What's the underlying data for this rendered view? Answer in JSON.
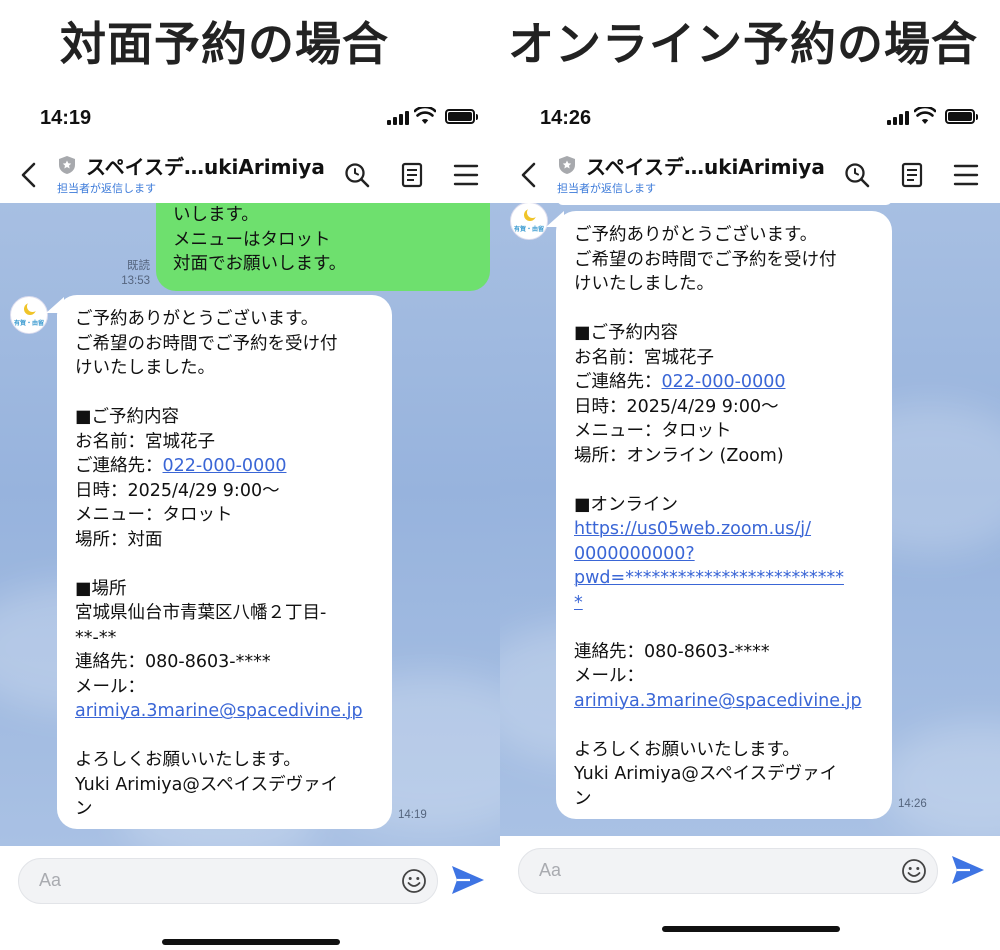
{
  "headings": {
    "left": "対面予約の場合",
    "right": "オンライン予約の場合"
  },
  "left_phone": {
    "status_time": "14:19",
    "chat_title": "スペイスデ…ukiArimiya",
    "chat_subtitle": "担当者が返信します",
    "outgoing": {
      "lines": [
        "いします。",
        "メニューはタロット",
        "対面でお願いします。"
      ],
      "read_label": "既読",
      "time": "13:53"
    },
    "incoming": {
      "avatar_text": "有賀・由留",
      "lines": [
        {
          "text": "ご予約ありがとうございます。"
        },
        {
          "text": "ご希望のお時間でご予約を受け付"
        },
        {
          "text": "けいたしました。"
        },
        {
          "text": ""
        },
        {
          "text": "■ご予約内容"
        },
        {
          "text": "お名前：宮城花子"
        },
        {
          "text": "ご連絡先：",
          "link": "022-000-0000"
        },
        {
          "text": "日時：2025/4/29 9:00～"
        },
        {
          "text": "メニュー：タロット"
        },
        {
          "text": "場所：対面"
        },
        {
          "text": ""
        },
        {
          "text": "■場所"
        },
        {
          "text": "宮城県仙台市青葉区八幡２丁目-"
        },
        {
          "text": "**-**"
        },
        {
          "text": "連絡先：080-8603-****"
        },
        {
          "text": "メール："
        },
        {
          "text": "",
          "link": "arimiya.3marine@spacedivine.jp"
        },
        {
          "text": ""
        },
        {
          "text": "よろしくお願いいたします。"
        },
        {
          "text": "Yuki Arimiya@スペイスデヴァイ"
        },
        {
          "text": "ン"
        }
      ],
      "time": "14:19"
    },
    "input_placeholder": "Aa"
  },
  "right_phone": {
    "status_time": "14:26",
    "chat_title": "スペイスデ…ukiArimiya",
    "chat_subtitle": "担当者が返信します",
    "incoming": {
      "avatar_text": "有賀・由留",
      "lines": [
        {
          "text": "ご予約ありがとうございます。"
        },
        {
          "text": "ご希望のお時間でご予約を受け付"
        },
        {
          "text": "けいたしました。"
        },
        {
          "text": ""
        },
        {
          "text": "■ご予約内容"
        },
        {
          "text": "お名前：宮城花子"
        },
        {
          "text": "ご連絡先：",
          "link": "022-000-0000"
        },
        {
          "text": "日時：2025/4/29 9:00～"
        },
        {
          "text": "メニュー：タロット"
        },
        {
          "text": "場所：オンライン (Zoom)"
        },
        {
          "text": ""
        },
        {
          "text": "■オンライン"
        },
        {
          "text": "",
          "link": "https://us05web.zoom.us/j/"
        },
        {
          "text": "",
          "link": "0000000000?"
        },
        {
          "text": "",
          "link": "pwd=*************************"
        },
        {
          "text": "",
          "link": "*"
        },
        {
          "text": ""
        },
        {
          "text": "連絡先：080-8603-****"
        },
        {
          "text": "メール："
        },
        {
          "text": "",
          "link": "arimiya.3marine@spacedivine.jp"
        },
        {
          "text": ""
        },
        {
          "text": "よろしくお願いいたします。"
        },
        {
          "text": "Yuki Arimiya@スペイスデヴァイ"
        },
        {
          "text": "ン"
        }
      ],
      "time": "14:26"
    },
    "input_placeholder": "Aa"
  },
  "colors": {
    "chat_bg": "#9ab5df",
    "outgoing_bubble": "#6ee06e",
    "link": "#3a66d6",
    "send": "#3e74e3"
  },
  "icons": [
    "back-chevron",
    "shield",
    "search",
    "notes",
    "menu",
    "emoji",
    "send"
  ]
}
